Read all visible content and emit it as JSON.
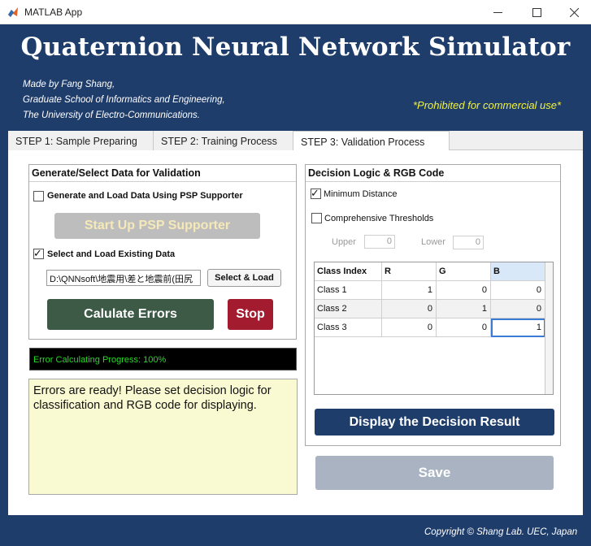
{
  "window": {
    "title": "MATLAB App"
  },
  "header": {
    "title": "Quaternion Neural Network Simulator",
    "credits": [
      "Made by Fang Shang,",
      "Graduate School of Informatics and Engineering,",
      "The University of Electro-Communications."
    ],
    "prohibited": "*Prohibited for commercial use*",
    "copyright": "Copyright © Shang Lab. UEC, Japan"
  },
  "tabs": [
    {
      "label": "STEP 1: Sample Preparing"
    },
    {
      "label": "STEP 2: Training Process"
    },
    {
      "label": "STEP 3: Validation Process"
    }
  ],
  "left_panel": {
    "title": "Generate/Select Data for Validation",
    "generate_checkbox": {
      "label": "Generate and Load  Data Using PSP Supporter",
      "checked": false
    },
    "psp_button": "Start Up PSP Supporter",
    "select_checkbox": {
      "label": "Select and Load Existing  Data",
      "checked": true
    },
    "path_value": "D:\\QNNsoft\\地震用\\差と地震前(田尻",
    "select_load_button": "Select & Load",
    "calculate_button": "Calulate Errors",
    "stop_button": "Stop"
  },
  "progress": {
    "text": "Error Calculating Progress: 100%",
    "value": 100
  },
  "message": "Errors are ready! Please set decision logic for classification and RGB code for displaying.",
  "right_panel": {
    "title": "Decision Logic & RGB Code",
    "min_distance": {
      "label": "Minimum Distance",
      "checked": true
    },
    "comprehensive": {
      "label": "Comprehensive Thresholds",
      "checked": false
    },
    "upper_label": "Upper",
    "upper_value": "0",
    "lower_label": "Lower",
    "lower_value": "0",
    "table": {
      "headers": [
        "Class Index",
        "R",
        "G",
        "B"
      ],
      "rows": [
        [
          "Class 1",
          "1",
          "0",
          "0"
        ],
        [
          "Class 2",
          "0",
          "1",
          "0"
        ],
        [
          "Class 3",
          "0",
          "0",
          "1"
        ]
      ]
    },
    "display_button": "Display the Decision Result"
  },
  "save_button": "Save",
  "colors": {
    "background": "#1f3d6b",
    "accent_button": "#1f3d6b",
    "calculate_button": "#3c5a45",
    "stop_button": "#a31b2e",
    "disabled_button": "#a9b3c1",
    "progress_text": "#22dd22",
    "prohibited_text": "#f2f23a"
  }
}
